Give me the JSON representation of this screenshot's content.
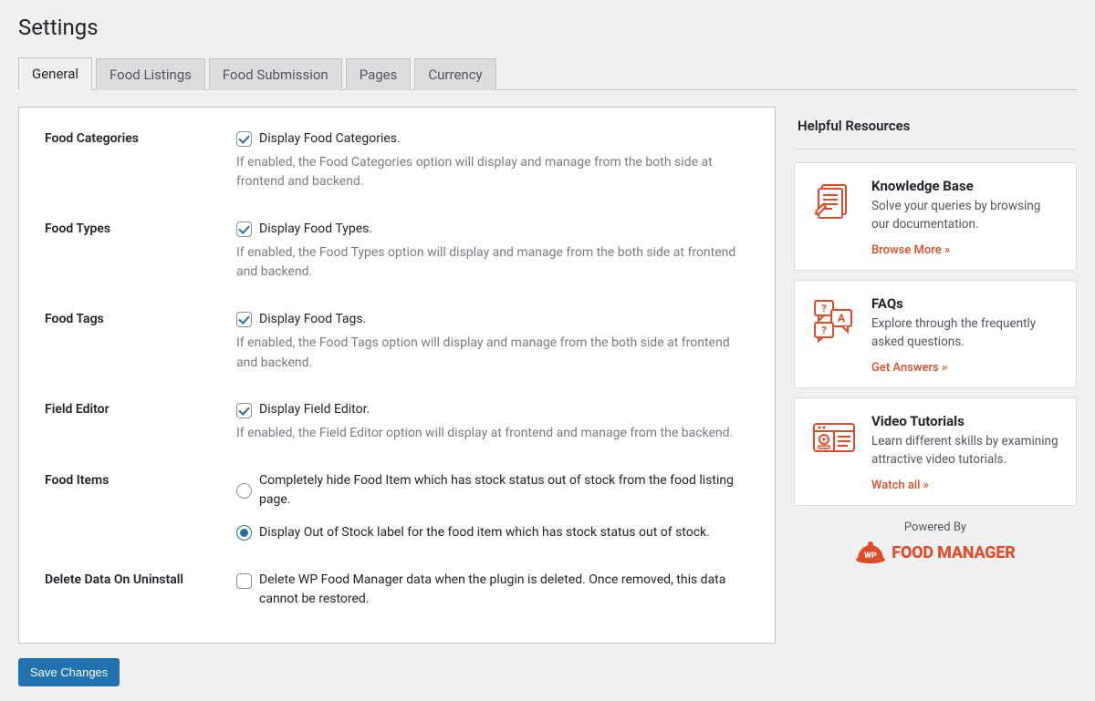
{
  "page_title": "Settings",
  "tabs": [
    {
      "label": "General",
      "active": true
    },
    {
      "label": "Food Listings",
      "active": false
    },
    {
      "label": "Food Submission",
      "active": false
    },
    {
      "label": "Pages",
      "active": false
    },
    {
      "label": "Currency",
      "active": false
    }
  ],
  "settings": {
    "food_categories": {
      "label": "Food Categories",
      "option": "Display Food Categories.",
      "checked": true,
      "desc": "If enabled, the Food Categories option will display and manage from the both side at frontend and backend."
    },
    "food_types": {
      "label": "Food Types",
      "option": "Display Food Types.",
      "checked": true,
      "desc": "If enabled, the Food Types option will display and manage from the both side at frontend and backend."
    },
    "food_tags": {
      "label": "Food Tags",
      "option": "Display Food Tags.",
      "checked": true,
      "desc": "If enabled, the Food Tags option will display and manage from the both side at frontend and backend."
    },
    "field_editor": {
      "label": "Field Editor",
      "option": "Display Field Editor.",
      "checked": true,
      "desc": "If enabled, the Field Editor option will display at frontend and manage from the backend."
    },
    "food_items": {
      "label": "Food Items",
      "options": [
        {
          "label": "Completely hide Food Item which has stock status out of stock from the food listing page.",
          "selected": false
        },
        {
          "label": "Display Out of Stock label for the food item which has stock status out of stock.",
          "selected": true
        }
      ]
    },
    "delete_data": {
      "label": "Delete Data On Uninstall",
      "option": "Delete WP Food Manager data when the plugin is deleted. Once removed, this data cannot be restored.",
      "checked": false
    }
  },
  "save_button": "Save Changes",
  "sidebar": {
    "title": "Helpful Resources",
    "resources": [
      {
        "title": "Knowledge Base",
        "desc": "Solve your queries by browsing our documentation.",
        "link": "Browse More  »"
      },
      {
        "title": "FAQs",
        "desc": "Explore through the frequently asked questions.",
        "link": "Get Answers  »"
      },
      {
        "title": "Video Tutorials",
        "desc": "Learn different skills by examining attractive video tutorials.",
        "link": "Watch all  »"
      }
    ],
    "powered_by": "Powered By",
    "brand": "FOOD MANAGER",
    "brand_tag": "WP"
  }
}
